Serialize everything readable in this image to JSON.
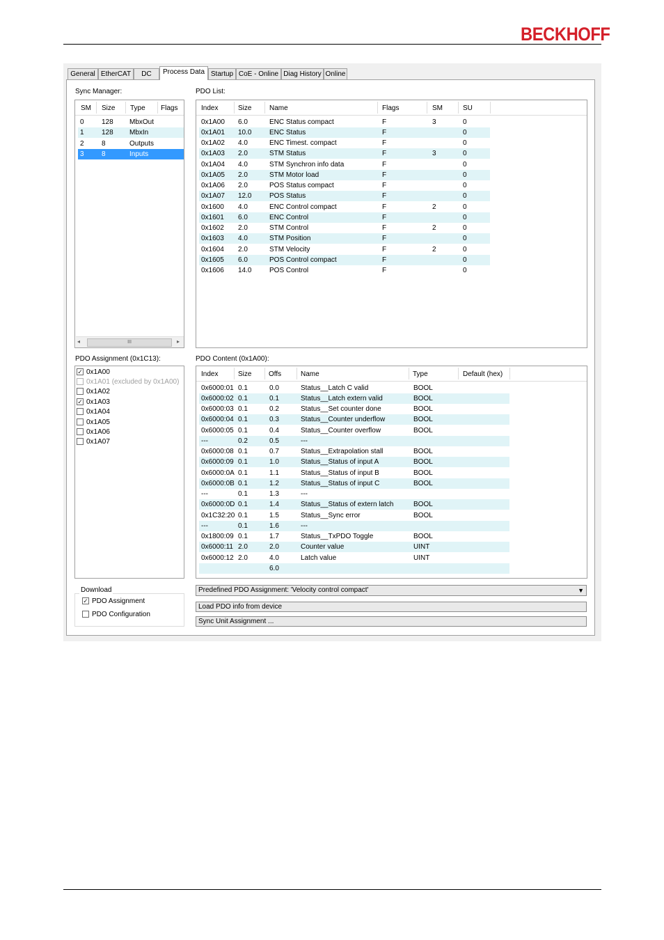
{
  "brand": "BECKHOFF",
  "tabs": [
    "General",
    "EtherCAT",
    "DC",
    "Process Data",
    "Startup",
    "CoE - Online",
    "Diag History",
    "Online"
  ],
  "active_tab": "Process Data",
  "sync_manager": {
    "label": "Sync Manager:",
    "columns": [
      "SM",
      "Size",
      "Type",
      "Flags"
    ],
    "rows": [
      {
        "sm": "0",
        "size": "128",
        "type": "MbxOut",
        "flags": ""
      },
      {
        "sm": "1",
        "size": "128",
        "type": "MbxIn",
        "flags": ""
      },
      {
        "sm": "2",
        "size": "8",
        "type": "Outputs",
        "flags": ""
      },
      {
        "sm": "3",
        "size": "8",
        "type": "Inputs",
        "flags": ""
      }
    ],
    "selected_index": 3,
    "scroll_thumb": "III"
  },
  "pdo_list": {
    "label": "PDO List:",
    "columns": [
      "Index",
      "Size",
      "Name",
      "Flags",
      "SM",
      "SU"
    ],
    "rows": [
      {
        "index": "0x1A00",
        "size": "6.0",
        "name": "ENC Status compact",
        "flags": "F",
        "sm": "3",
        "su": "0"
      },
      {
        "index": "0x1A01",
        "size": "10.0",
        "name": "ENC Status",
        "flags": "F",
        "sm": "",
        "su": "0"
      },
      {
        "index": "0x1A02",
        "size": "4.0",
        "name": "ENC Timest. compact",
        "flags": "F",
        "sm": "",
        "su": "0"
      },
      {
        "index": "0x1A03",
        "size": "2.0",
        "name": "STM Status",
        "flags": "F",
        "sm": "3",
        "su": "0"
      },
      {
        "index": "0x1A04",
        "size": "4.0",
        "name": "STM Synchron info data",
        "flags": "F",
        "sm": "",
        "su": "0"
      },
      {
        "index": "0x1A05",
        "size": "2.0",
        "name": "STM Motor load",
        "flags": "F",
        "sm": "",
        "su": "0"
      },
      {
        "index": "0x1A06",
        "size": "2.0",
        "name": "POS Status compact",
        "flags": "F",
        "sm": "",
        "su": "0"
      },
      {
        "index": "0x1A07",
        "size": "12.0",
        "name": "POS Status",
        "flags": "F",
        "sm": "",
        "su": "0"
      },
      {
        "index": "0x1600",
        "size": "4.0",
        "name": "ENC Control compact",
        "flags": "F",
        "sm": "2",
        "su": "0"
      },
      {
        "index": "0x1601",
        "size": "6.0",
        "name": "ENC Control",
        "flags": "F",
        "sm": "",
        "su": "0"
      },
      {
        "index": "0x1602",
        "size": "2.0",
        "name": "STM Control",
        "flags": "F",
        "sm": "2",
        "su": "0"
      },
      {
        "index": "0x1603",
        "size": "4.0",
        "name": "STM Position",
        "flags": "F",
        "sm": "",
        "su": "0"
      },
      {
        "index": "0x1604",
        "size": "2.0",
        "name": "STM Velocity",
        "flags": "F",
        "sm": "2",
        "su": "0"
      },
      {
        "index": "0x1605",
        "size": "6.0",
        "name": "POS Control compact",
        "flags": "F",
        "sm": "",
        "su": "0"
      },
      {
        "index": "0x1606",
        "size": "14.0",
        "name": "POS Control",
        "flags": "F",
        "sm": "",
        "su": "0"
      }
    ]
  },
  "pdo_assignment": {
    "label": "PDO Assignment (0x1C13):",
    "items": [
      {
        "label": "0x1A00",
        "checked": true,
        "disabled": false
      },
      {
        "label": "0x1A01 (excluded by 0x1A00)",
        "checked": false,
        "disabled": true
      },
      {
        "label": "0x1A02",
        "checked": false,
        "disabled": false
      },
      {
        "label": "0x1A03",
        "checked": true,
        "disabled": false
      },
      {
        "label": "0x1A04",
        "checked": false,
        "disabled": false
      },
      {
        "label": "0x1A05",
        "checked": false,
        "disabled": false
      },
      {
        "label": "0x1A06",
        "checked": false,
        "disabled": false
      },
      {
        "label": "0x1A07",
        "checked": false,
        "disabled": false
      }
    ]
  },
  "pdo_content": {
    "label": "PDO Content (0x1A00):",
    "columns": [
      "Index",
      "Size",
      "Offs",
      "Name",
      "Type",
      "Default (hex)"
    ],
    "rows": [
      {
        "index": "0x6000:01",
        "size": "0.1",
        "offs": "0.0",
        "name": "Status__Latch C valid",
        "type": "BOOL"
      },
      {
        "index": "0x6000:02",
        "size": "0.1",
        "offs": "0.1",
        "name": "Status__Latch extern valid",
        "type": "BOOL"
      },
      {
        "index": "0x6000:03",
        "size": "0.1",
        "offs": "0.2",
        "name": "Status__Set counter done",
        "type": "BOOL"
      },
      {
        "index": "0x6000:04",
        "size": "0.1",
        "offs": "0.3",
        "name": "Status__Counter underflow",
        "type": "BOOL"
      },
      {
        "index": "0x6000:05",
        "size": "0.1",
        "offs": "0.4",
        "name": "Status__Counter overflow",
        "type": "BOOL"
      },
      {
        "index": "---",
        "size": "0.2",
        "offs": "0.5",
        "name": "---",
        "type": ""
      },
      {
        "index": "0x6000:08",
        "size": "0.1",
        "offs": "0.7",
        "name": "Status__Extrapolation stall",
        "type": "BOOL"
      },
      {
        "index": "0x6000:09",
        "size": "0.1",
        "offs": "1.0",
        "name": "Status__Status of input A",
        "type": "BOOL"
      },
      {
        "index": "0x6000:0A",
        "size": "0.1",
        "offs": "1.1",
        "name": "Status__Status of input B",
        "type": "BOOL"
      },
      {
        "index": "0x6000:0B",
        "size": "0.1",
        "offs": "1.2",
        "name": "Status__Status of input C",
        "type": "BOOL"
      },
      {
        "index": "---",
        "size": "0.1",
        "offs": "1.3",
        "name": "---",
        "type": ""
      },
      {
        "index": "0x6000:0D",
        "size": "0.1",
        "offs": "1.4",
        "name": "Status__Status of extern latch",
        "type": "BOOL"
      },
      {
        "index": "0x1C32:20",
        "size": "0.1",
        "offs": "1.5",
        "name": "Status__Sync error",
        "type": "BOOL"
      },
      {
        "index": "---",
        "size": "0.1",
        "offs": "1.6",
        "name": "---",
        "type": ""
      },
      {
        "index": "0x1800:09",
        "size": "0.1",
        "offs": "1.7",
        "name": "Status__TxPDO Toggle",
        "type": "BOOL"
      },
      {
        "index": "0x6000:11",
        "size": "2.0",
        "offs": "2.0",
        "name": "Counter value",
        "type": "UINT"
      },
      {
        "index": "0x6000:12",
        "size": "2.0",
        "offs": "4.0",
        "name": "Latch value",
        "type": "UINT"
      },
      {
        "index": "",
        "size": "",
        "offs": "6.0",
        "name": "",
        "type": ""
      }
    ]
  },
  "download": {
    "label": "Download",
    "items": [
      {
        "label": "PDO Assignment",
        "checked": true
      },
      {
        "label": "PDO Configuration",
        "checked": false
      }
    ]
  },
  "predefined": {
    "value": "Predefined PDO Assignment: 'Velocity control compact'"
  },
  "buttons": {
    "load": "Load PDO info from device",
    "sync_unit": "Sync Unit Assignment ..."
  }
}
